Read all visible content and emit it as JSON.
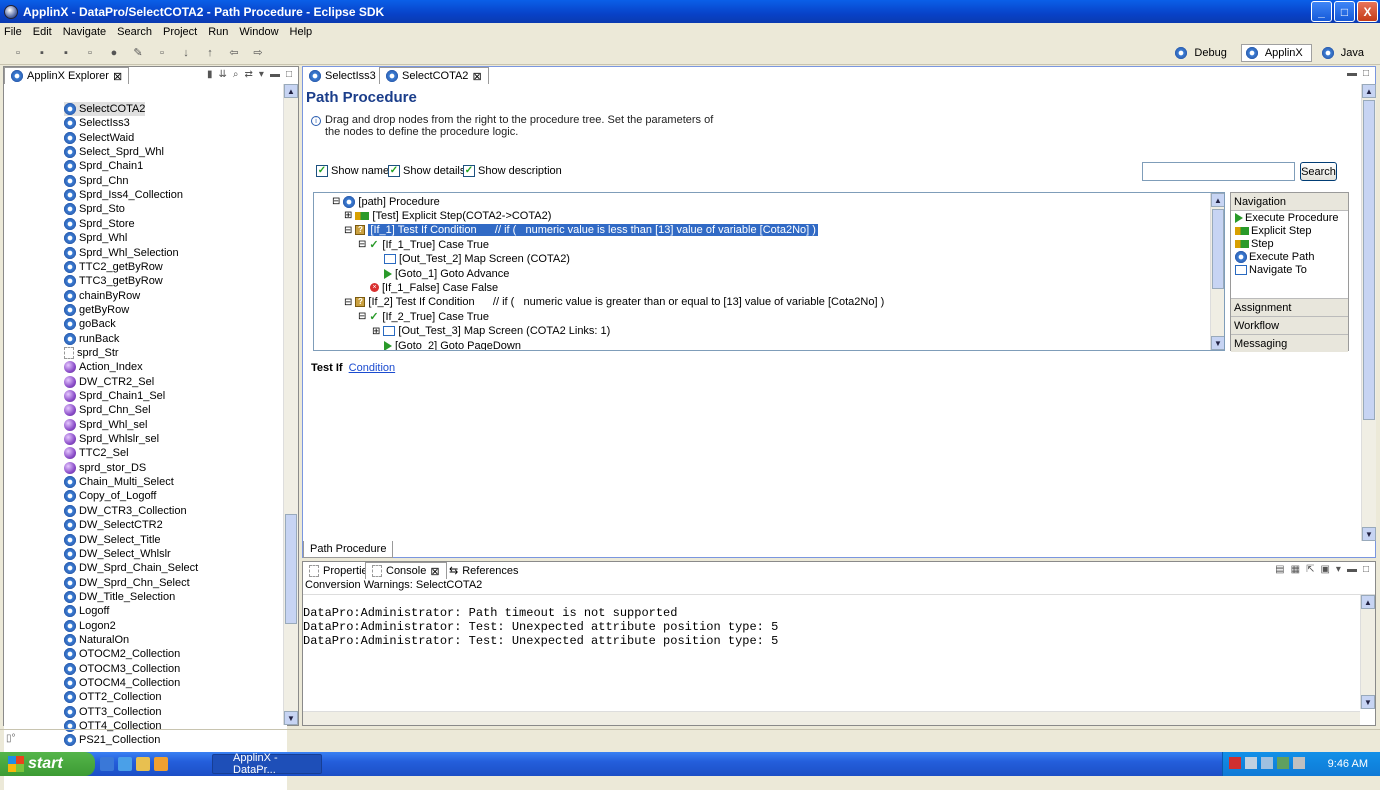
{
  "window": {
    "title": "ApplinX - DataPro/SelectCOTA2 - Path Procedure - Eclipse SDK",
    "min": "_",
    "max": "□",
    "close": "X"
  },
  "menu": [
    "File",
    "Edit",
    "Navigate",
    "Search",
    "Project",
    "Run",
    "Window",
    "Help"
  ],
  "perspectives": {
    "debug": "Debug",
    "applinx": "ApplinX",
    "java": "Java"
  },
  "explorer": {
    "tab": "ApplinX Explorer",
    "items": [
      {
        "label": "SelectCOTA2",
        "icon": "gear-icon"
      },
      {
        "label": "SelectIss3",
        "icon": "gear-icon"
      },
      {
        "label": "SelectWaid",
        "icon": "gear-icon"
      },
      {
        "label": "Select_Sprd_Whl",
        "icon": "gear-icon"
      },
      {
        "label": "Sprd_Chain1",
        "icon": "gear-icon"
      },
      {
        "label": "Sprd_Chn",
        "icon": "gear-icon"
      },
      {
        "label": "Sprd_Iss4_Collection",
        "icon": "gear-icon"
      },
      {
        "label": "Sprd_Sto",
        "icon": "gear-icon"
      },
      {
        "label": "Sprd_Store",
        "icon": "gear-icon"
      },
      {
        "label": "Sprd_Whl",
        "icon": "gear-icon"
      },
      {
        "label": "Sprd_Whl_Selection",
        "icon": "gear-icon"
      },
      {
        "label": "TTC2_getByRow",
        "icon": "gear-icon"
      },
      {
        "label": "TTC3_getByRow",
        "icon": "gear-icon"
      },
      {
        "label": "chainByRow",
        "icon": "gear-icon"
      },
      {
        "label": "getByRow",
        "icon": "gear-icon"
      },
      {
        "label": "goBack",
        "icon": "gear-icon"
      },
      {
        "label": "runBack",
        "icon": "gear-icon"
      },
      {
        "label": "sprd_Str",
        "icon": "doc-icon"
      },
      {
        "label": "Action_Index",
        "icon": "ball-icon"
      },
      {
        "label": "DW_CTR2_Sel",
        "icon": "ball-icon"
      },
      {
        "label": "Sprd_Chain1_Sel",
        "icon": "ball-icon"
      },
      {
        "label": "Sprd_Chn_Sel",
        "icon": "ball-icon"
      },
      {
        "label": "Sprd_Whl_sel",
        "icon": "ball-icon"
      },
      {
        "label": "Sprd_Whlslr_sel",
        "icon": "ball-icon"
      },
      {
        "label": "TTC2_Sel",
        "icon": "ball-icon"
      },
      {
        "label": "sprd_stor_DS",
        "icon": "ball-icon"
      },
      {
        "label": "Chain_Multi_Select",
        "icon": "gear-icon"
      },
      {
        "label": "Copy_of_Logoff",
        "icon": "gear-icon"
      },
      {
        "label": "DW_CTR3_Collection",
        "icon": "gear-icon"
      },
      {
        "label": "DW_SelectCTR2",
        "icon": "gear-icon"
      },
      {
        "label": "DW_Select_Title",
        "icon": "gear-icon"
      },
      {
        "label": "DW_Select_Whlslr",
        "icon": "gear-icon"
      },
      {
        "label": "DW_Sprd_Chain_Select",
        "icon": "gear-icon"
      },
      {
        "label": "DW_Sprd_Chn_Select",
        "icon": "gear-icon"
      },
      {
        "label": "DW_Title_Selection",
        "icon": "gear-icon"
      },
      {
        "label": "Logoff",
        "icon": "gear-icon"
      },
      {
        "label": "Logon2",
        "icon": "gear-icon"
      },
      {
        "label": "NaturalOn",
        "icon": "gear-icon"
      },
      {
        "label": "OTOCM2_Collection",
        "icon": "gear-icon"
      },
      {
        "label": "OTOCM3_Collection",
        "icon": "gear-icon"
      },
      {
        "label": "OTOCM4_Collection",
        "icon": "gear-icon"
      },
      {
        "label": "OTT2_Collection",
        "icon": "gear-icon"
      },
      {
        "label": "OTT3_Collection",
        "icon": "gear-icon"
      },
      {
        "label": "OTT4_Collection",
        "icon": "gear-icon"
      },
      {
        "label": "PS21_Collection",
        "icon": "gear-icon"
      }
    ]
  },
  "editor_tabs": [
    "SelectIss3",
    "SelectCOTA2"
  ],
  "editor": {
    "title": "Path Procedure",
    "info_line1": "Drag and drop nodes from the right to the procedure tree. Set the parameters of",
    "info_line2": "the nodes to define the procedure logic.",
    "show_name": "Show name",
    "show_details": "Show details",
    "show_description": "Show description",
    "search_btn": "Search",
    "search_value": "",
    "tree": [
      {
        "text": "[path] Procedure",
        "toggle": "⊟",
        "icon": "gear-icon"
      },
      {
        "text": "[Test] Explicit Step(COTA2->COTA2)",
        "toggle": "⊞",
        "icon": "step-icon"
      },
      {
        "text": "[If_1] Test If Condition      // if (   numeric value is less than [13] value of variable [Cota2No] )",
        "toggle": "⊟",
        "icon": "question-icon"
      },
      {
        "text": "[If_1_True] Case True",
        "toggle": "⊟",
        "icon": "check-icon"
      },
      {
        "text": "[Out_Test_2] Map Screen (COTA2)",
        "toggle": "",
        "icon": "map-icon"
      },
      {
        "text": "[Goto_1] Goto Advance",
        "toggle": "",
        "icon": "goto-icon"
      },
      {
        "text": "[If_1_False] Case False",
        "toggle": "",
        "icon": "x-icon"
      },
      {
        "text": "[If_2] Test If Condition      // if (   numeric value is greater than or equal to [13] value of variable [Cota2No] )",
        "toggle": "⊟",
        "icon": "question-icon"
      },
      {
        "text": "[If_2_True] Case True",
        "toggle": "⊟",
        "icon": "check-icon"
      },
      {
        "text": "[Out_Test_3] Map Screen (COTA2 Links: 1)",
        "toggle": "⊞",
        "icon": "map-icon"
      },
      {
        "text": "[Goto_2] Goto PageDown",
        "toggle": "",
        "icon": "goto-icon"
      }
    ],
    "palette_head": "Navigation",
    "palette_items": [
      "Execute Procedure",
      "Explicit Step",
      "Step",
      "Execute Path",
      "Navigate To"
    ],
    "palette_sections": [
      "Assignment",
      "Workflow",
      "Messaging"
    ],
    "props_label": "Test If",
    "props_link": "Condition",
    "bottom_tab": "Path Procedure"
  },
  "bottom": {
    "tabs": [
      "Properties",
      "Console",
      "References"
    ],
    "header": "Conversion Warnings: SelectCOTA2",
    "lines": [
      "DataPro:Administrator: Path timeout is not supported",
      "DataPro:Administrator: Test: Unexpected attribute position type: 5",
      "DataPro:Administrator: Test: Unexpected attribute position type: 5"
    ]
  },
  "taskbar": {
    "start": "start",
    "task": "ApplinX - DataPr...",
    "clock": "9:46 AM"
  }
}
